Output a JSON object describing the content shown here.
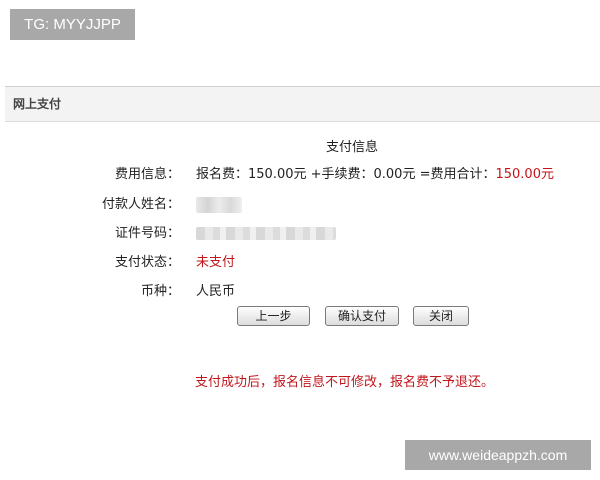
{
  "watermark_top": "TG: MYYJJPP",
  "watermark_bottom": "www.weideappzh.com",
  "panel": {
    "title": "网上支付"
  },
  "section_title": "支付信息",
  "fields": {
    "fee": {
      "label": "费用信息：",
      "text": "报名费：150.00元 +手续费：0.00元 =费用合计：",
      "total": "150.00元"
    },
    "payer_name": {
      "label": "付款人姓名："
    },
    "id_number": {
      "label": "证件号码："
    },
    "status": {
      "label": "支付状态：",
      "value": "未支付"
    },
    "currency": {
      "label": "币种：",
      "value": "人民币"
    }
  },
  "buttons": {
    "prev": "上一步",
    "confirm": "确认支付",
    "close": "关闭"
  },
  "notice": "支付成功后，报名信息不可修改，报名费不予退还。",
  "colors": {
    "warning_red": "#c0161c",
    "panel_header_bg": "#f3f3f3"
  }
}
